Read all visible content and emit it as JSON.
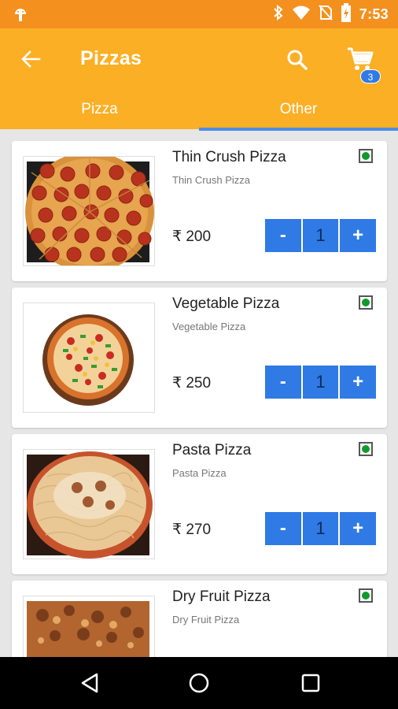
{
  "status_bar": {
    "time": "7:53",
    "icons": [
      "android-icon",
      "bluetooth-icon",
      "wifi-icon",
      "no-sim-icon",
      "battery-charging-icon"
    ]
  },
  "app_bar": {
    "title": "Pizzas",
    "cart_count": "3",
    "icons": [
      "back-arrow-icon",
      "search-icon",
      "cart-icon"
    ]
  },
  "tabs": [
    {
      "label": "Pizza",
      "active": false
    },
    {
      "label": "Other",
      "active": true
    }
  ],
  "products": [
    {
      "name": "Thin Crush Pizza",
      "subtitle": "Thin Crush Pizza",
      "price": "₹ 200",
      "quantity": "1",
      "image": "pepperoni-pizza-image"
    },
    {
      "name": "Vegetable Pizza",
      "subtitle": "Vegetable Pizza",
      "price": "₹ 250",
      "quantity": "1",
      "image": "vegetable-pizza-image"
    },
    {
      "name": "Pasta Pizza",
      "subtitle": "Pasta Pizza",
      "price": "₹ 270",
      "quantity": "1",
      "image": "pasta-pizza-image"
    },
    {
      "name": "Dry Fruit Pizza",
      "subtitle": "Dry Fruit Pizza",
      "image": "dry-fruit-pizza-image"
    }
  ],
  "stepper": {
    "minus": "-",
    "plus": "+"
  },
  "nav_bar": {
    "icons": [
      "back-triangle-icon",
      "home-circle-icon",
      "recents-square-icon"
    ]
  },
  "colors": {
    "status_bar": "#f4901e",
    "app_bar": "#fbaf25",
    "tab_indicator": "#4a8de6",
    "stepper": "#2f7ae5",
    "veg_dot": "#119a2c",
    "background": "#e6e6e6"
  }
}
